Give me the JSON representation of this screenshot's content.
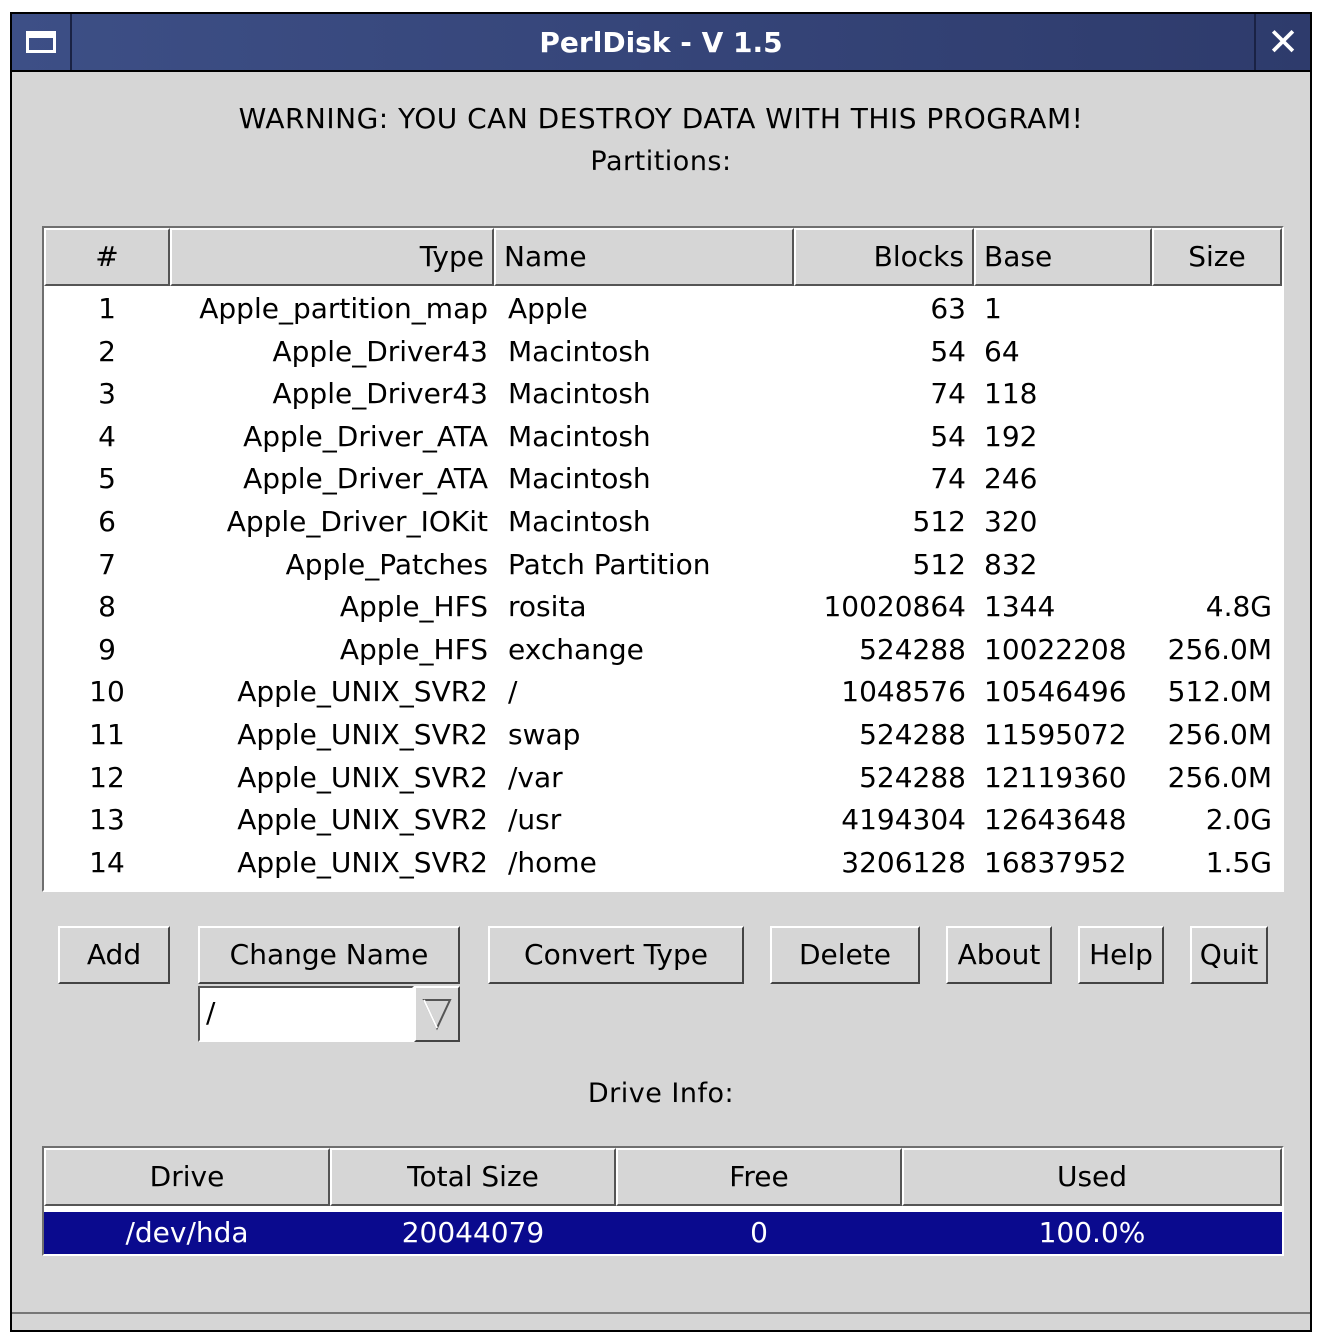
{
  "window": {
    "title": "PerlDisk - V 1.5"
  },
  "warning": "WARNING: YOU CAN DESTROY DATA WITH THIS PROGRAM!",
  "partitions_label": "Partitions:",
  "partitions_table": {
    "headers": [
      "#",
      "Type",
      "Name",
      "Blocks",
      "Base",
      "Size"
    ],
    "rows": [
      [
        "1",
        "Apple_partition_map",
        "Apple",
        "63",
        "1",
        ""
      ],
      [
        "2",
        "Apple_Driver43",
        "Macintosh",
        "54",
        "64",
        ""
      ],
      [
        "3",
        "Apple_Driver43",
        "Macintosh",
        "74",
        "118",
        ""
      ],
      [
        "4",
        "Apple_Driver_ATA",
        "Macintosh",
        "54",
        "192",
        ""
      ],
      [
        "5",
        "Apple_Driver_ATA",
        "Macintosh",
        "74",
        "246",
        ""
      ],
      [
        "6",
        "Apple_Driver_IOKit",
        "Macintosh",
        "512",
        "320",
        ""
      ],
      [
        "7",
        "Apple_Patches",
        "Patch Partition",
        "512",
        "832",
        ""
      ],
      [
        "8",
        "Apple_HFS",
        "rosita",
        "10020864",
        "1344",
        "4.8G"
      ],
      [
        "9",
        "Apple_HFS",
        "exchange",
        "524288",
        "10022208",
        "256.0M"
      ],
      [
        "10",
        "Apple_UNIX_SVR2",
        "/",
        "1048576",
        "10546496",
        "512.0M"
      ],
      [
        "11",
        "Apple_UNIX_SVR2",
        "swap",
        "524288",
        "11595072",
        "256.0M"
      ],
      [
        "12",
        "Apple_UNIX_SVR2",
        "/var",
        "524288",
        "12119360",
        "256.0M"
      ],
      [
        "13",
        "Apple_UNIX_SVR2",
        "/usr",
        "4194304",
        "12643648",
        "2.0G"
      ],
      [
        "14",
        "Apple_UNIX_SVR2",
        "/home",
        "3206128",
        "16837952",
        "1.5G"
      ]
    ]
  },
  "buttons": {
    "add": "Add",
    "change_name": "Change Name",
    "convert_type": "Convert Type",
    "delete": "Delete",
    "about": "About",
    "help": "Help",
    "quit": "Quit"
  },
  "name_combo": {
    "value": "/"
  },
  "drive_info_label": "Drive Info:",
  "drive_table": {
    "headers": [
      "Drive",
      "Total Size",
      "Free",
      "Used"
    ],
    "rows": [
      [
        "/dev/hda",
        "20044079",
        "0",
        "100.0%"
      ]
    ],
    "selected_color": "#0a0a8e"
  },
  "colors": {
    "window_bg": "#d6d6d6",
    "titlebar": "#34447a",
    "selection": "#0a0a8e"
  }
}
